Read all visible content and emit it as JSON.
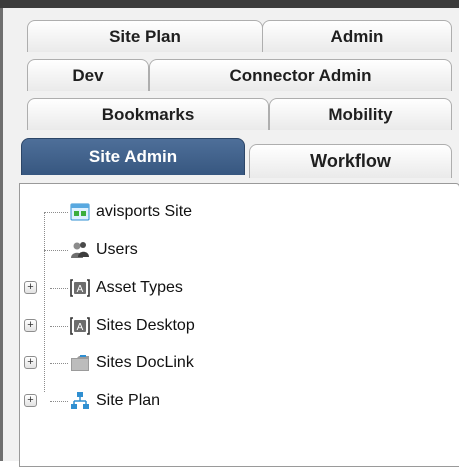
{
  "tabs": {
    "row1": [
      "Site Plan",
      "Admin"
    ],
    "row2": [
      "Dev",
      "Connector Admin"
    ],
    "row3": [
      "Bookmarks",
      "Mobility"
    ],
    "row4": [
      "Site Admin",
      "Workflow"
    ],
    "active": "Site Admin"
  },
  "tree": {
    "items": [
      {
        "label": "avisports Site",
        "icon": "site-icon",
        "expandable": false
      },
      {
        "label": "Users",
        "icon": "users-icon",
        "expandable": false
      },
      {
        "label": "Asset Types",
        "icon": "asset-type-icon",
        "expandable": true
      },
      {
        "label": "Sites Desktop",
        "icon": "asset-type-icon",
        "expandable": true
      },
      {
        "label": "Sites DocLink",
        "icon": "folder-icon",
        "expandable": true
      },
      {
        "label": "Site Plan",
        "icon": "site-plan-icon",
        "expandable": true
      }
    ]
  },
  "colors": {
    "active_tab": "#375780",
    "tab_border": "#aeaeae",
    "tree_bg": "#ffffff"
  }
}
